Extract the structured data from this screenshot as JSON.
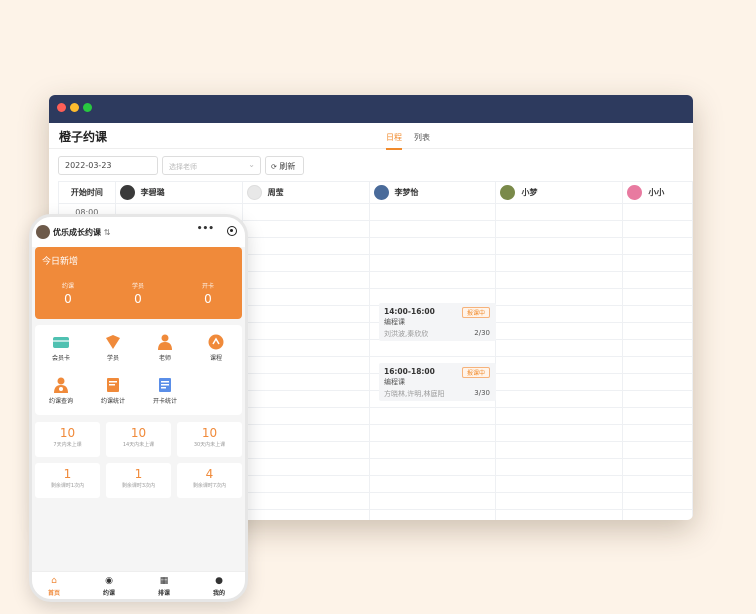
{
  "desktop": {
    "app_title": "橙子约课",
    "tabs": [
      "日程",
      "列表"
    ],
    "date_value": "2022-03-23",
    "teacher_placeholder": "选择老师",
    "refresh_label": "刷新",
    "time_header": "开始时间",
    "first_time": "08:00",
    "teachers": [
      {
        "name": "李碧璐",
        "avatar_color": "#3a3a3a"
      },
      {
        "name": "周莹",
        "avatar_color": "#e8e8e8"
      },
      {
        "name": "李梦怡",
        "avatar_color": "#4a6b9a"
      },
      {
        "name": "小梦",
        "avatar_color": "#7a8a4a"
      },
      {
        "name": "小小",
        "avatar_color": "#e87aa0"
      }
    ],
    "lessons": [
      {
        "time": "14:00-16:00",
        "name": "编程课",
        "members": "刘洪波,秦欣欣",
        "count": "2/30",
        "status": "报课中"
      },
      {
        "time": "16:00-18:00",
        "name": "编程课",
        "members": "方晓林,许明,林庭阳",
        "count": "3/30",
        "status": "报课中"
      }
    ]
  },
  "mobile": {
    "title": "优乐成长约课",
    "title_suffix": "⇅",
    "more_label": "•••",
    "today_title": "今日新增",
    "today_stats": [
      {
        "label": "约课",
        "value": "0"
      },
      {
        "label": "学员",
        "value": "0"
      },
      {
        "label": "开卡",
        "value": "0"
      }
    ],
    "menu": [
      {
        "label": "会员卡",
        "icon": "member-card-icon",
        "color": "#4fc1b1"
      },
      {
        "label": "学员",
        "icon": "student-icon",
        "color": "#f08a3a"
      },
      {
        "label": "老师",
        "icon": "teacher-icon",
        "color": "#f08a3a"
      },
      {
        "label": "课程",
        "icon": "course-icon",
        "color": "#f08a3a"
      },
      {
        "label": "约课查询",
        "icon": "booking-query-icon",
        "color": "#f08a3a"
      },
      {
        "label": "约课统计",
        "icon": "booking-stats-icon",
        "color": "#f08a3a"
      },
      {
        "label": "开卡统计",
        "icon": "card-stats-icon",
        "color": "#5a8ee8"
      }
    ],
    "stats": [
      {
        "value": "10",
        "label": "7天内未上课"
      },
      {
        "value": "10",
        "label": "14天内未上课"
      },
      {
        "value": "10",
        "label": "30天内未上课"
      },
      {
        "value": "1",
        "label": "剩余课时1次内"
      },
      {
        "value": "1",
        "label": "剩余课时3次内"
      },
      {
        "value": "4",
        "label": "剩余课时7次内"
      }
    ],
    "nav": [
      "首页",
      "约课",
      "排课",
      "我的"
    ],
    "accent": "#f08a3a"
  }
}
